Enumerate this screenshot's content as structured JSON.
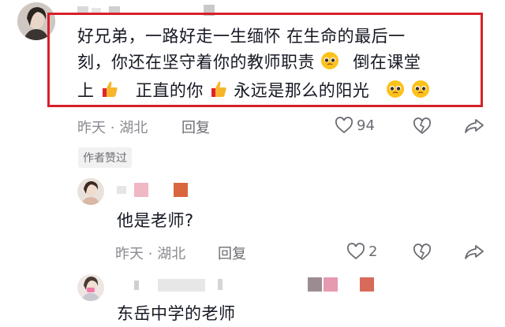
{
  "comments": [
    {
      "text_parts": [
        "好兄弟，一路好走一生缅怀 在生命的最后一",
        "刻，你还在坚守着你的教师职责",
        "倒在课堂",
        "上",
        "正直的你",
        "永远是那么的阳光"
      ],
      "time": "昨天",
      "location": "湖北",
      "reply_label": "回复",
      "likes": "94",
      "badge": "作者赞过"
    },
    {
      "text": "他是老师?",
      "time": "昨天",
      "location": "湖北",
      "reply_label": "回复",
      "likes": "2"
    },
    {
      "text": "东岳中学的老师"
    }
  ],
  "meta_separator": "·",
  "icons": [
    "heart-outline-icon",
    "broken-heart-icon",
    "share-arrow-icon",
    "pleading-face-emoji",
    "thumbs-up-emoji"
  ],
  "colors": {
    "highlight_border": "#d7202a",
    "meta_gray": "#8a8b91"
  }
}
